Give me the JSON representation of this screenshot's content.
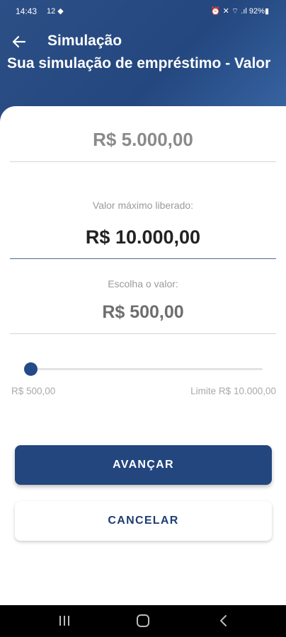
{
  "status_bar": {
    "time": "14:43",
    "left_icons": "12 ◆",
    "right_icons": "⏰ ✕ ⌔ .ıl 92%▮"
  },
  "appbar": {
    "back_icon": "arrow-left-icon",
    "title": "Simulação"
  },
  "page_title": "Sua simulação de empréstimo - Valor",
  "requested_amount": "R$ 5.000,00",
  "max_label": "Valor máximo liberado:",
  "max_amount": "R$ 10.000,00",
  "choose_label": "Escolha o valor:",
  "chosen_amount": "R$ 500,00",
  "slider": {
    "min_label": "R$ 500,00",
    "max_label": "Limite R$ 10.000,00",
    "min": 500,
    "max": 10000,
    "value": 500
  },
  "buttons": {
    "primary": "AVANÇAR",
    "secondary": "CANCELAR"
  },
  "colors": {
    "primary": "#24467f",
    "header": "#2c4f86"
  }
}
